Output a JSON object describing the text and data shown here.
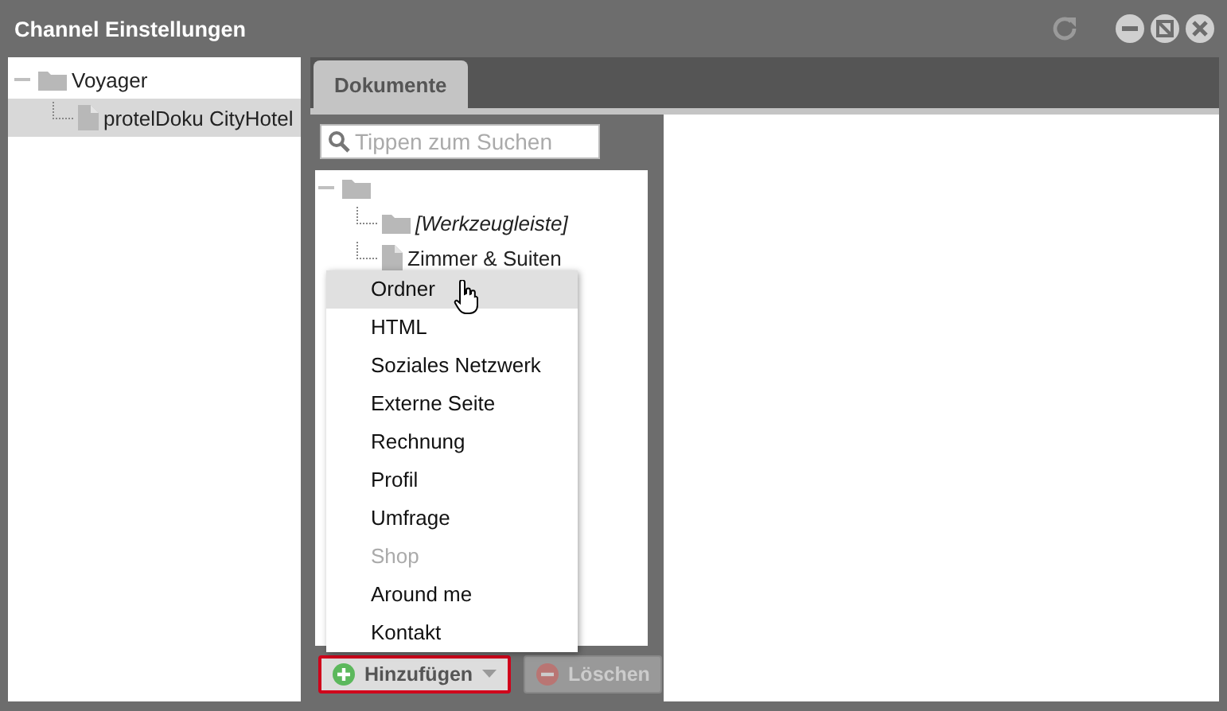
{
  "window": {
    "title": "Channel Einstellungen"
  },
  "channel_tree": [
    {
      "label": "Voyager",
      "kind": "folder",
      "expanded": true,
      "selected": false,
      "children": [
        {
          "label": "protelDoku CityHotel",
          "kind": "document",
          "selected": true
        }
      ]
    }
  ],
  "tabs": [
    {
      "label": "Dokumente",
      "selected": true
    }
  ],
  "search": {
    "placeholder": "Tippen zum Suchen"
  },
  "document_tree": [
    {
      "kind": "folder",
      "expanded": true,
      "children": [
        {
          "label": "[Werkzeugleiste]",
          "kind": "folder",
          "italic": true
        },
        {
          "label": "Zimmer & Suiten",
          "kind": "document",
          "italic": false
        }
      ]
    }
  ],
  "add_menu": [
    {
      "label": "Ordner",
      "hovered": true,
      "disabled": false
    },
    {
      "label": "HTML",
      "hovered": false,
      "disabled": false
    },
    {
      "label": "Soziales Netzwerk",
      "hovered": false,
      "disabled": false
    },
    {
      "label": "Externe Seite",
      "hovered": false,
      "disabled": false
    },
    {
      "label": "Rechnung",
      "hovered": false,
      "disabled": false
    },
    {
      "label": "Profil",
      "hovered": false,
      "disabled": false
    },
    {
      "label": "Umfrage",
      "hovered": false,
      "disabled": false
    },
    {
      "label": "Shop",
      "hovered": false,
      "disabled": true
    },
    {
      "label": "Around me",
      "hovered": false,
      "disabled": false
    },
    {
      "label": "Kontakt",
      "hovered": false,
      "disabled": false
    }
  ],
  "buttons": [
    {
      "label": "Hinzufügen",
      "kind": "add",
      "disabled": false,
      "focused": true
    },
    {
      "label": "Löschen",
      "kind": "delete",
      "disabled": true,
      "focused": false
    }
  ]
}
